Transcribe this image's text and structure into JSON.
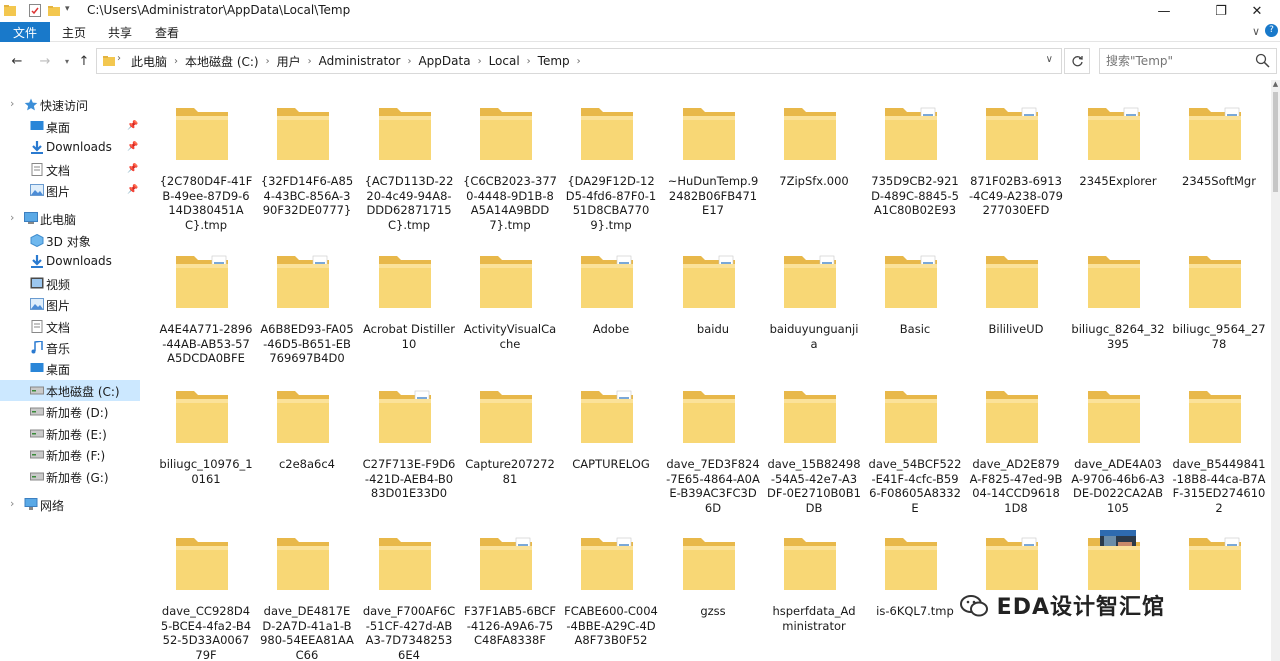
{
  "window": {
    "title": "C:\\Users\\Administrator\\AppData\\Local\\Temp",
    "minimize": "—",
    "maximize": "❐",
    "close": "✕"
  },
  "ribbon": {
    "tabs": [
      "文件",
      "主页",
      "共享",
      "查看"
    ],
    "expand": "∨",
    "help": "?"
  },
  "address": {
    "crumbs": [
      "此电脑",
      "本地磁盘 (C:)",
      "用户",
      "Administrator",
      "AppData",
      "Local",
      "Temp"
    ],
    "separator": "›",
    "search_placeholder": "搜索\"Temp\""
  },
  "nav": [
    {
      "label": "快速访问",
      "icon": "star-icon",
      "pinned": false
    },
    {
      "label": "桌面",
      "icon": "desktop-icon",
      "pinned": true
    },
    {
      "label": "Downloads",
      "icon": "download-icon",
      "pinned": true
    },
    {
      "label": "文档",
      "icon": "document-icon",
      "pinned": true
    },
    {
      "label": "图片",
      "icon": "picture-icon",
      "pinned": true
    },
    {
      "label": "此电脑",
      "icon": "computer-icon",
      "pinned": false
    },
    {
      "label": "3D 对象",
      "icon": "cube-icon",
      "pinned": false
    },
    {
      "label": "Downloads",
      "icon": "download-icon",
      "pinned": false
    },
    {
      "label": "视频",
      "icon": "video-icon",
      "pinned": false
    },
    {
      "label": "图片",
      "icon": "picture-icon",
      "pinned": false
    },
    {
      "label": "文档",
      "icon": "document-icon",
      "pinned": false
    },
    {
      "label": "音乐",
      "icon": "music-icon",
      "pinned": false
    },
    {
      "label": "桌面",
      "icon": "desktop-icon",
      "pinned": false
    },
    {
      "label": "本地磁盘 (C:)",
      "icon": "drive-icon",
      "pinned": false,
      "selected": true
    },
    {
      "label": "新加卷 (D:)",
      "icon": "drive-icon",
      "pinned": false
    },
    {
      "label": "新加卷 (E:)",
      "icon": "drive-icon",
      "pinned": false
    },
    {
      "label": "新加卷 (F:)",
      "icon": "drive-icon",
      "pinned": false
    },
    {
      "label": "新加卷 (G:)",
      "icon": "drive-icon",
      "pinned": false
    },
    {
      "label": "网络",
      "icon": "network-icon",
      "pinned": false
    }
  ],
  "items": [
    {
      "name": "{2C780D4F-41FB-49ee-87D9-614D380451AC}.tmp",
      "type": "folder"
    },
    {
      "name": "{32FD14F6-A854-43BC-856A-390F32DE0777}",
      "type": "folder"
    },
    {
      "name": "{AC7D113D-2220-4c49-94A8-DDD62871715C}.tmp",
      "type": "folder"
    },
    {
      "name": "{C6CB2023-3770-4448-9D1B-8A5A14A9BDD7}.tmp",
      "type": "folder"
    },
    {
      "name": "{DA29F12D-12D5-4fd6-87F0-151D8CBA7709}.tmp",
      "type": "folder"
    },
    {
      "name": "~HuDunTemp.92482B06FB471E17",
      "type": "folder"
    },
    {
      "name": "7ZipSfx.000",
      "type": "folder"
    },
    {
      "name": "735D9CB2-921D-489C-8845-5A1C80B02E93",
      "type": "folder-files"
    },
    {
      "name": "871F02B3-6913-4C49-A238-079277030EFD",
      "type": "folder-files"
    },
    {
      "name": "2345Explorer",
      "type": "folder-files"
    },
    {
      "name": "2345SoftMgr",
      "type": "folder-files"
    },
    {
      "name": "A4E4A771-2896-44AB-AB53-57A5DCDA0BFE",
      "type": "folder-files"
    },
    {
      "name": "A6B8ED93-FA05-46D5-B651-EB769697B4D0",
      "type": "folder-files"
    },
    {
      "name": "Acrobat Distiller 10",
      "type": "folder"
    },
    {
      "name": "ActivityVisualCache",
      "type": "folder"
    },
    {
      "name": "Adobe",
      "type": "folder-files"
    },
    {
      "name": "baidu",
      "type": "folder-files"
    },
    {
      "name": "baiduyunguanjia",
      "type": "folder-files"
    },
    {
      "name": "Basic",
      "type": "folder-files"
    },
    {
      "name": "BililiveUD",
      "type": "folder"
    },
    {
      "name": "biliugc_8264_32395",
      "type": "folder"
    },
    {
      "name": "biliugc_9564_2778",
      "type": "folder"
    },
    {
      "name": "biliugc_10976_10161",
      "type": "folder"
    },
    {
      "name": "c2e8a6c4",
      "type": "folder"
    },
    {
      "name": "C27F713E-F9D6-421D-AEB4-B083D01E33D0",
      "type": "folder-files"
    },
    {
      "name": "Capture20727281",
      "type": "folder"
    },
    {
      "name": "CAPTURELOG",
      "type": "folder-files"
    },
    {
      "name": "dave_7ED3F824-7E65-4864-A0AE-B39AC3FC3D6D",
      "type": "folder"
    },
    {
      "name": "dave_15B82498-54A5-42e7-A3DF-0E2710B0B1DB",
      "type": "folder"
    },
    {
      "name": "dave_54BCF522-E41F-4cfc-B596-F08605A8332E",
      "type": "folder"
    },
    {
      "name": "dave_AD2E879A-F825-47ed-9B04-14CCD96181D8",
      "type": "folder"
    },
    {
      "name": "dave_ADE4A03A-9706-46b6-A3DE-D022CA2AB105",
      "type": "folder"
    },
    {
      "name": "dave_B5449841-18B8-44ca-B7AF-315ED2746102",
      "type": "folder"
    },
    {
      "name": "dave_CC928D45-BCE4-4fa2-B452-5D33A006779F",
      "type": "folder"
    },
    {
      "name": "dave_DE4817ED-2A7D-41a1-B980-54EEA81AAC66",
      "type": "folder"
    },
    {
      "name": "dave_F700AF6C-51CF-427d-ABA3-7D73482536E4",
      "type": "folder"
    },
    {
      "name": "F37F1AB5-6BCF-4126-A9A6-75C48FA8338F",
      "type": "folder-files"
    },
    {
      "name": "FCABE600-C004-4BBE-A29C-4DA8F73B0F52",
      "type": "folder-files"
    },
    {
      "name": "gzss",
      "type": "folder"
    },
    {
      "name": "hsperfdata_Administrator",
      "type": "folder"
    },
    {
      "name": "is-6KQL7.tmp",
      "type": "folder"
    },
    {
      "name": "",
      "type": "folder-files"
    },
    {
      "name": "",
      "type": "folder-photo"
    },
    {
      "name": "",
      "type": "folder-files"
    }
  ],
  "watermark": "EDA设计智汇馆",
  "colors": {
    "accent": "#1979ca",
    "selected": "#cce8ff",
    "folder": "#f8d775",
    "folder_dark": "#e8b84a"
  }
}
